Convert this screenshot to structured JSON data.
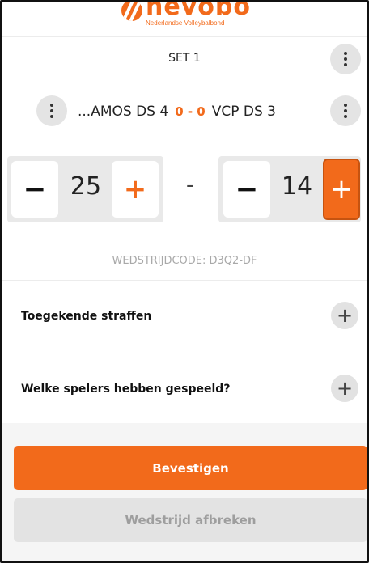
{
  "header": {
    "logo_word": "nevobo",
    "logo_subtitle": "Nederlandse Volleybalbond"
  },
  "set": {
    "label": "SET 1"
  },
  "teams": {
    "home": "...AMOS DS 4",
    "away": "VCP DS 3",
    "sets_score": "0 - 0"
  },
  "score": {
    "home": "25",
    "away": "14",
    "minus_label": "−",
    "plus_label": "+",
    "separator": "-"
  },
  "match": {
    "code_text": "WEDSTRIJDCODE: D3Q2-DF"
  },
  "sections": [
    {
      "label": "Toegekende straffen",
      "action_icon": "plus-icon"
    },
    {
      "label": "Welke spelers hebben gespeeld?",
      "action_icon": "plus-icon"
    }
  ],
  "actions": {
    "confirm_label": "Bevestigen",
    "abort_label": "Wedstrijd afbreken"
  },
  "colors": {
    "accent": "#f26a1b",
    "muted": "#a9a9a9",
    "panel": "#e9e9e9"
  },
  "icons": {
    "more": "kebab-icon",
    "add": "plus-icon",
    "remove": "minus-icon",
    "logo": "volleyball-icon"
  }
}
